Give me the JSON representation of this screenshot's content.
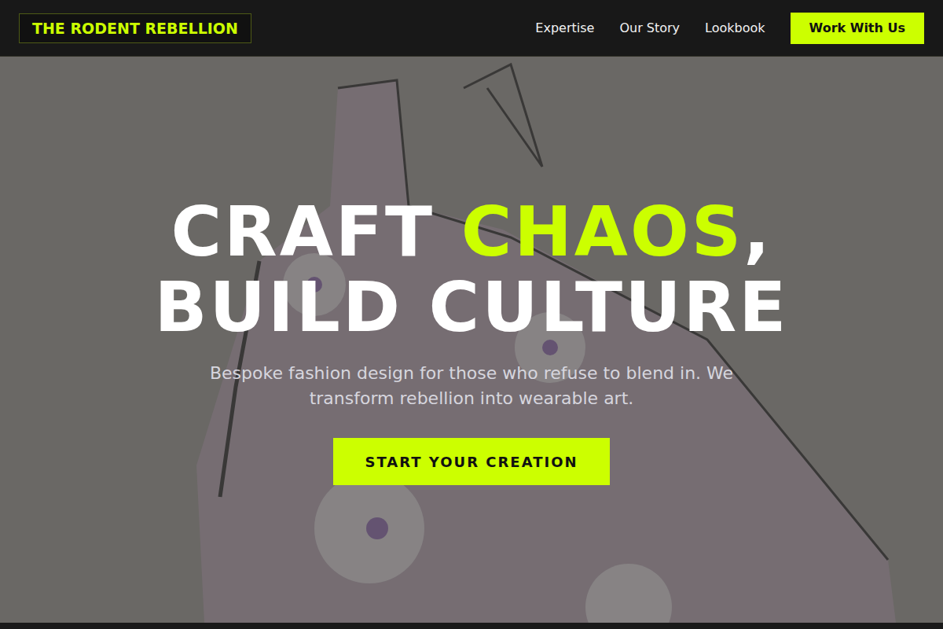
{
  "brand": {
    "name": "THE RODENT REBELLION"
  },
  "nav": {
    "links": [
      "Expertise",
      "Our Story",
      "Lookbook"
    ],
    "cta": "Work With Us"
  },
  "hero": {
    "headline_start": "CRAFT",
    "headline_accent": "CHAOS",
    "headline_end": ",",
    "headline_line2": "BUILD CULTURE",
    "subtitle": "Bespoke fashion design for those who refuse to blend in. We transform rebellion into wearable art.",
    "button": "START YOUR CREATION"
  }
}
